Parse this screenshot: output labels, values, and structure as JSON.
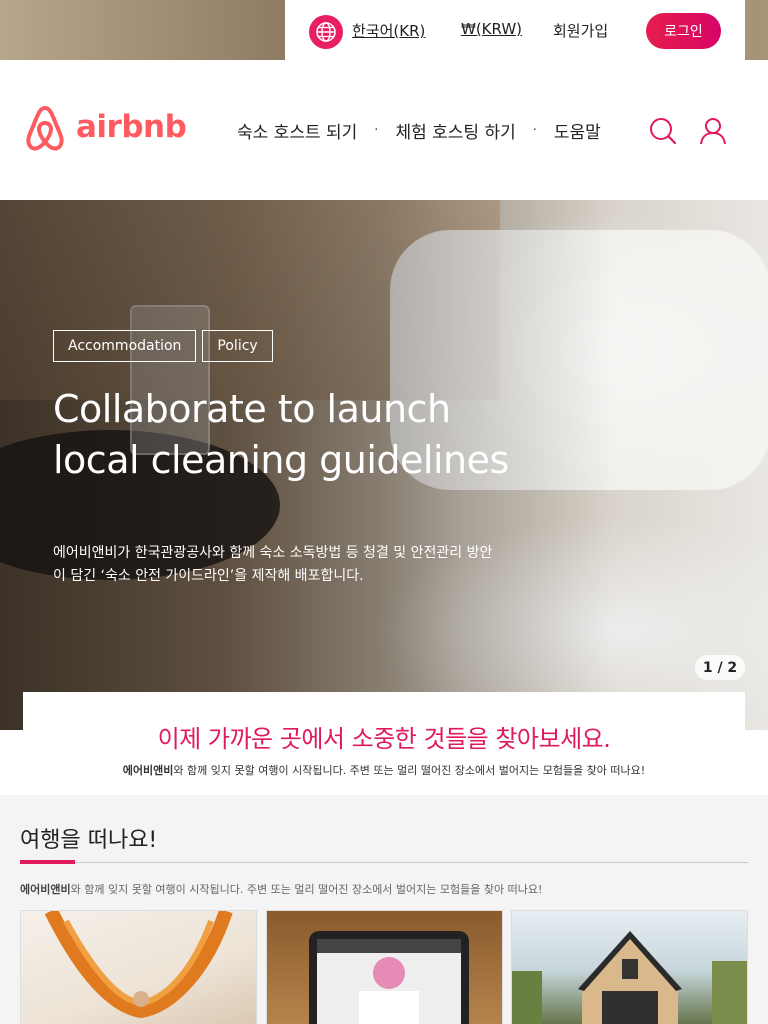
{
  "topbar": {
    "language": "한국어(KR)",
    "currency": "₩(KRW)",
    "signup": "회원가입",
    "login": "로그인"
  },
  "header": {
    "logo_text": "airbnb",
    "nav": [
      "숙소 호스트 되기",
      "체험 호스팅 하기",
      "도움말"
    ],
    "nav_separator": "·"
  },
  "hero": {
    "tags": [
      "Accommodation",
      "Policy"
    ],
    "title_line1": "Collaborate to launch",
    "title_line2": "local cleaning guidelines",
    "desc_line1": "에어비앤비가 한국관광공사와 함께 숙소 소독방법 등 청결 및 안전관리 방안",
    "desc_line2": "이 담긴 ‘숙소 안전 가이드라인’을 제작해 배포합니다.",
    "pager": "1 / 2"
  },
  "promo": {
    "title": "이제 가까운 곳에서 소중한 것들을 찾아보세요.",
    "brand": "에어비앤비",
    "sub": "와 함께 잊지 못할 여행이 시작됩니다. 주변 또는 멀리 떨어진 장소에서 벌어지는 모험들을 찾아 떠나요!"
  },
  "section": {
    "title": "여행을 떠나요!",
    "brand": "에어비앤비",
    "desc": "와 함께 잊지 못할 여행이 시작됩니다. 주변 또는 멀리 떨어진 장소에서 벌어지는 모험들을 찾아 떠나요!"
  },
  "colors": {
    "brand": "#ff5a5f",
    "accent": "#e0195a",
    "login_gradient_start": "#e61e4d",
    "login_gradient_end": "#d70466"
  },
  "icons": {
    "globe": "globe-icon",
    "search": "search-icon",
    "user": "user-icon",
    "logo": "airbnb-belo-icon"
  }
}
